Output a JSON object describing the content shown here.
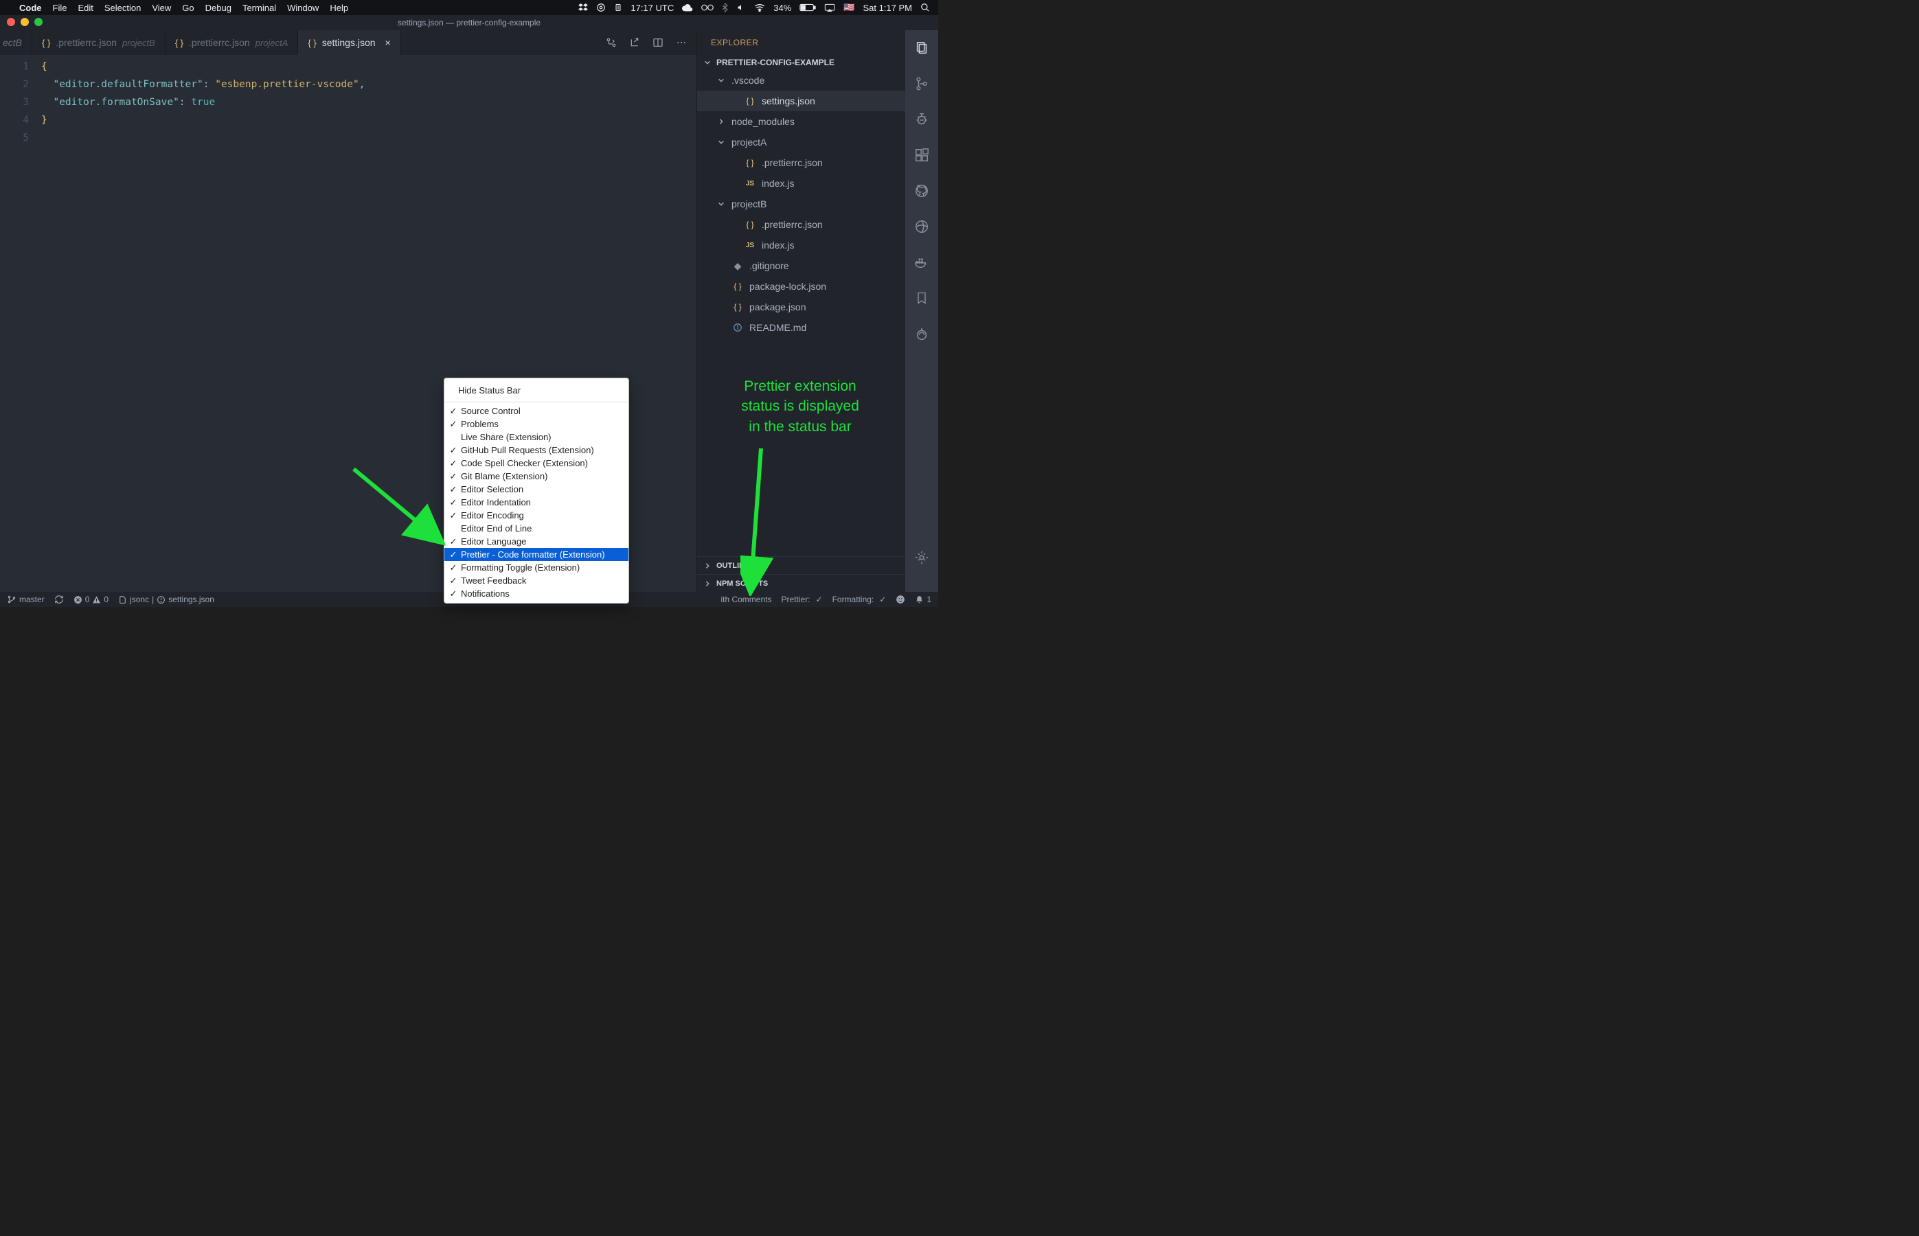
{
  "mac_menu": {
    "apple_icon": "",
    "app_name": "Code",
    "items": [
      "File",
      "Edit",
      "Selection",
      "View",
      "Go",
      "Debug",
      "Terminal",
      "Window",
      "Help"
    ],
    "right": {
      "time_utc": "17:17 UTC",
      "battery_pct": "34%",
      "clock": "Sat 1:17 PM"
    }
  },
  "title": "settings.json — prettier-config-example",
  "tabs": {
    "overflow_indicator": "ectB",
    "items": [
      {
        "icon": "{ }",
        "name": ".prettierrc.json",
        "project": "projectB",
        "active": false
      },
      {
        "icon": "{ }",
        "name": ".prettierrc.json",
        "project": "projectA",
        "active": false
      },
      {
        "icon": "{ }",
        "name": "settings.json",
        "project": "",
        "active": true
      }
    ]
  },
  "editor": {
    "lines": [
      {
        "n": "1",
        "tokens": [
          {
            "t": "{",
            "c": "brace"
          }
        ]
      },
      {
        "n": "2",
        "tokens": [
          {
            "t": "  ",
            "c": ""
          },
          {
            "t": "\"editor.defaultFormatter\"",
            "c": "key"
          },
          {
            "t": ": ",
            "c": "punc"
          },
          {
            "t": "\"esbenp.prettier-vscode\"",
            "c": "str"
          },
          {
            "t": ",",
            "c": "punc"
          }
        ],
        "hl": true
      },
      {
        "n": "3",
        "tokens": [
          {
            "t": "  ",
            "c": ""
          },
          {
            "t": "\"editor.formatOnSave\"",
            "c": "key"
          },
          {
            "t": ": ",
            "c": "punc"
          },
          {
            "t": "true",
            "c": "bool"
          }
        ],
        "hl": true
      },
      {
        "n": "4",
        "tokens": [
          {
            "t": "}",
            "c": "brace"
          }
        ]
      },
      {
        "n": "5",
        "tokens": []
      }
    ]
  },
  "explorer": {
    "title": "EXPLORER",
    "root": "PRETTIER-CONFIG-EXAMPLE",
    "tree": [
      {
        "type": "folder",
        "name": ".vscode",
        "expanded": true,
        "depth": 1
      },
      {
        "type": "file",
        "name": "settings.json",
        "icon": "json",
        "depth": 2,
        "active": true
      },
      {
        "type": "folder",
        "name": "node_modules",
        "expanded": false,
        "depth": 1
      },
      {
        "type": "folder",
        "name": "projectA",
        "expanded": true,
        "depth": 1
      },
      {
        "type": "file",
        "name": ".prettierrc.json",
        "icon": "json",
        "depth": 2
      },
      {
        "type": "file",
        "name": "index.js",
        "icon": "js",
        "depth": 2
      },
      {
        "type": "folder",
        "name": "projectB",
        "expanded": true,
        "depth": 1
      },
      {
        "type": "file",
        "name": ".prettierrc.json",
        "icon": "json",
        "depth": 2
      },
      {
        "type": "file",
        "name": "index.js",
        "icon": "js",
        "depth": 2
      },
      {
        "type": "file",
        "name": ".gitignore",
        "icon": "git",
        "depth": 1
      },
      {
        "type": "file",
        "name": "package-lock.json",
        "icon": "json",
        "depth": 1
      },
      {
        "type": "file",
        "name": "package.json",
        "icon": "json",
        "depth": 1
      },
      {
        "type": "file",
        "name": "README.md",
        "icon": "info",
        "depth": 1
      }
    ],
    "sections": [
      "OUTLINE",
      "NPM SCRIPTS"
    ]
  },
  "statusbar": {
    "branch": "master",
    "errors": "0",
    "warnings": "0",
    "lang_hint": "jsonc",
    "path_hint": "settings.json",
    "right": {
      "lang_mode": "ith Comments",
      "prettier": "Prettier:",
      "formatting": "Formatting:",
      "notif_count": "1"
    }
  },
  "context_menu": {
    "title": "Hide Status Bar",
    "items": [
      {
        "label": "Source Control",
        "checked": true
      },
      {
        "label": "Problems",
        "checked": true
      },
      {
        "label": "Live Share (Extension)",
        "checked": false
      },
      {
        "label": "GitHub Pull Requests (Extension)",
        "checked": true
      },
      {
        "label": "Code Spell Checker (Extension)",
        "checked": true
      },
      {
        "label": "Git Blame (Extension)",
        "checked": true
      },
      {
        "label": "Editor Selection",
        "checked": true
      },
      {
        "label": "Editor Indentation",
        "checked": true
      },
      {
        "label": "Editor Encoding",
        "checked": true
      },
      {
        "label": "Editor End of Line",
        "checked": false
      },
      {
        "label": "Editor Language",
        "checked": true
      },
      {
        "label": "Prettier - Code formatter (Extension)",
        "checked": true,
        "selected": true
      },
      {
        "label": "Formatting Toggle (Extension)",
        "checked": true
      },
      {
        "label": "Tweet Feedback",
        "checked": true
      },
      {
        "label": "Notifications",
        "checked": true
      }
    ]
  },
  "annotation": {
    "line1": "Prettier extension",
    "line2": "status is displayed",
    "line3": "in the status bar"
  }
}
